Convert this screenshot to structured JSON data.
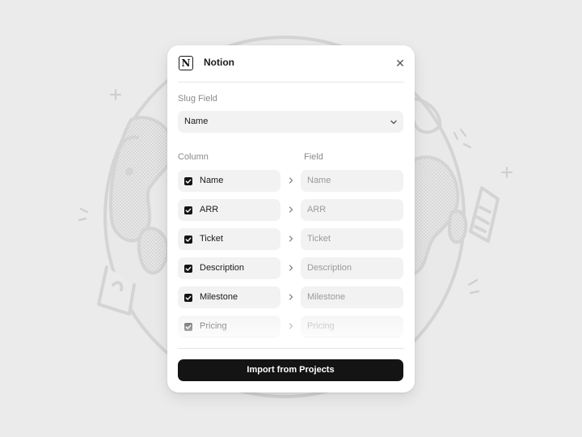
{
  "modal": {
    "app_name": "Notion",
    "logo_letter": "N",
    "close_symbol": "✕",
    "slug_field_label": "Slug Field",
    "slug_field_value": "Name",
    "column_header": "Column",
    "field_header": "Field",
    "import_button": "Import from Projects"
  },
  "mappings": [
    {
      "column": "Name",
      "field": "Name",
      "checked": true
    },
    {
      "column": "ARR",
      "field": "ARR",
      "checked": true
    },
    {
      "column": "Ticket",
      "field": "Ticket",
      "checked": true
    },
    {
      "column": "Description",
      "field": "Description",
      "checked": true
    },
    {
      "column": "Milestone",
      "field": "Milestone",
      "checked": true
    },
    {
      "column": "Pricing",
      "field": "Pricing",
      "checked": true
    }
  ],
  "icons": {
    "logo": "notion-logo-icon",
    "close": "close-icon",
    "dropdown": "chevron-down-icon",
    "arrow": "chevron-right-icon",
    "checkbox": "checkbox-checked-icon"
  },
  "colors": {
    "background": "#ebebeb",
    "modal": "#ffffff",
    "pill": "#f2f2f2",
    "accent": "#141414",
    "illustration_stroke": "#d4d4d4"
  }
}
